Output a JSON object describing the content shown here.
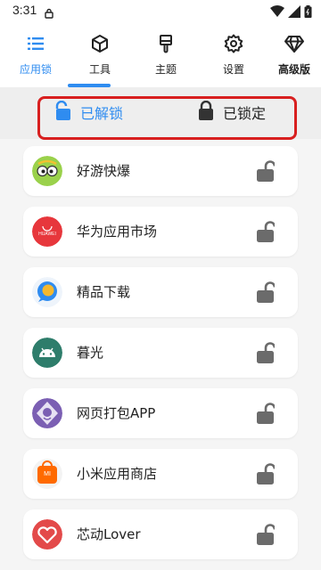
{
  "status_bar": {
    "time": "3:31"
  },
  "nav": {
    "tabs": [
      {
        "label": "应用锁",
        "icon": "list-icon",
        "active": true
      },
      {
        "label": "工具",
        "icon": "cube-icon"
      },
      {
        "label": "主题",
        "icon": "brush-icon"
      },
      {
        "label": "设置",
        "icon": "gear-icon"
      },
      {
        "label": "高级版",
        "icon": "diamond-icon"
      }
    ]
  },
  "filter": {
    "unlocked_label": "已解锁",
    "locked_label": "已锁定"
  },
  "apps": [
    {
      "name": "好游快爆",
      "icon": "haoyou-app-icon"
    },
    {
      "name": "华为应用市场",
      "icon": "huawei-appgallery-icon",
      "icon_text": "HUAWEI"
    },
    {
      "name": "精品下载",
      "icon": "jingpin-download-icon"
    },
    {
      "name": "暮光",
      "icon": "android-icon"
    },
    {
      "name": "网页打包APP",
      "icon": "webpack-app-icon"
    },
    {
      "name": "小米应用商店",
      "icon": "xiaomi-store-icon",
      "icon_text": "MI"
    },
    {
      "name": "芯动Lover",
      "icon": "heart-lover-icon"
    }
  ],
  "colors": {
    "accent": "#2f8cf0",
    "lock": "#6b6b6b",
    "highlight_frame": "#d81f1f"
  }
}
